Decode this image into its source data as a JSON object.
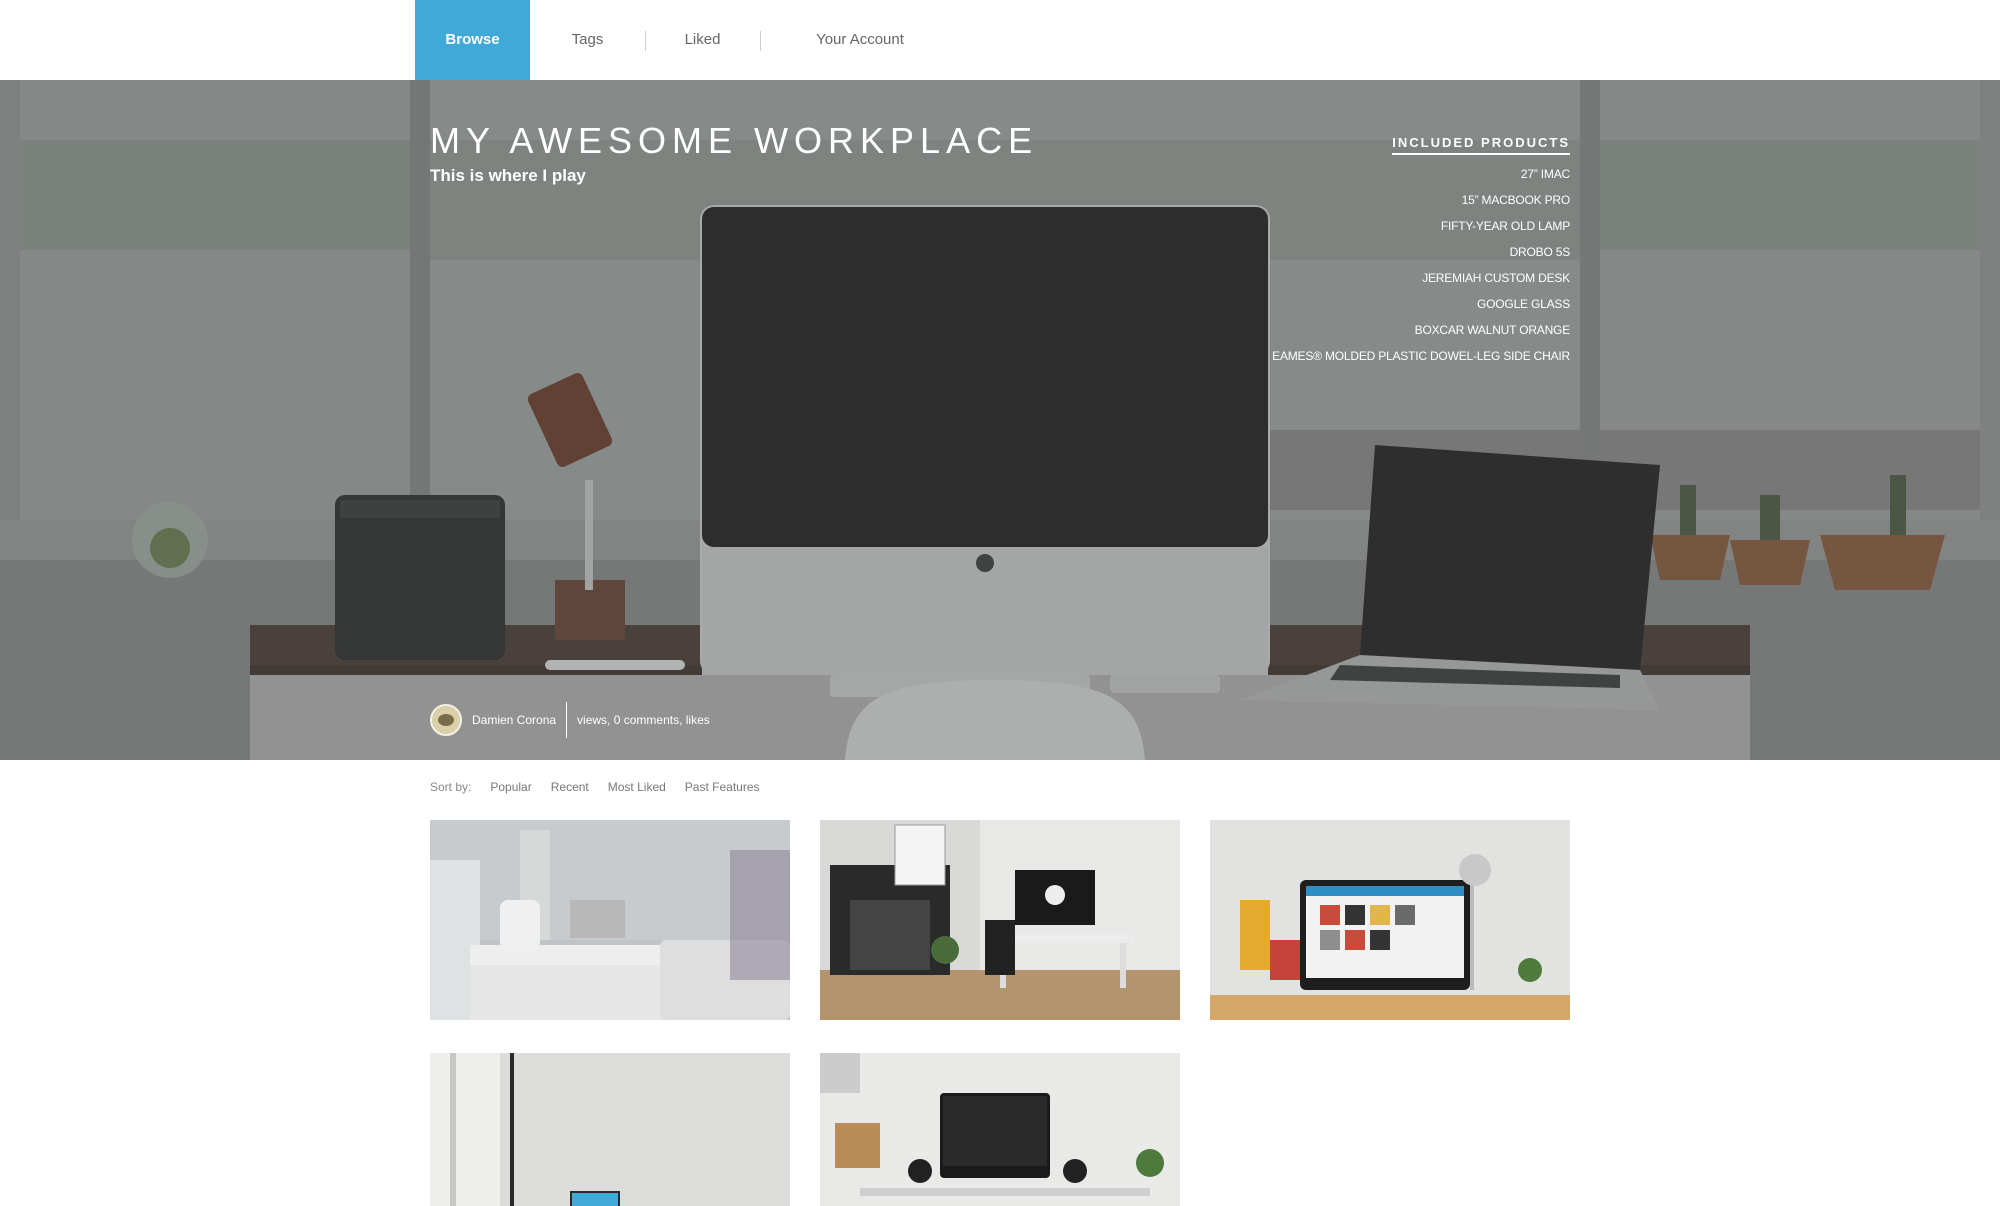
{
  "nav": {
    "items": [
      {
        "label": "Browse",
        "active": true
      },
      {
        "label": "Tags",
        "active": false
      },
      {
        "label": "Liked",
        "active": false
      },
      {
        "label": "Your Account",
        "active": false
      }
    ],
    "accent_color": "#3fa9d8"
  },
  "feature": {
    "title": "MY AWESOME WORKPLACE",
    "subtitle": "This is where I play",
    "products_heading": "INCLUDED PRODUCTS",
    "products": [
      "27” IMAC",
      "15” MACBOOK PRO",
      "FIFTY-YEAR OLD LAMP",
      "DROBO 5S",
      "JEREMIAH CUSTOM DESK",
      "GOOGLE GLASS",
      "BOXCAR WALNUT ORANGE",
      "EAMES® MOLDED PLASTIC DOWEL-LEG SIDE CHAIR"
    ],
    "author": "Damien Corona",
    "stats": "views, 0 comments, likes"
  },
  "sort": {
    "label": "Sort by:",
    "options": [
      "Popular",
      "Recent",
      "Most Liked",
      "Past Features"
    ]
  },
  "icons": {
    "author_avatar": "avatar-icon"
  }
}
